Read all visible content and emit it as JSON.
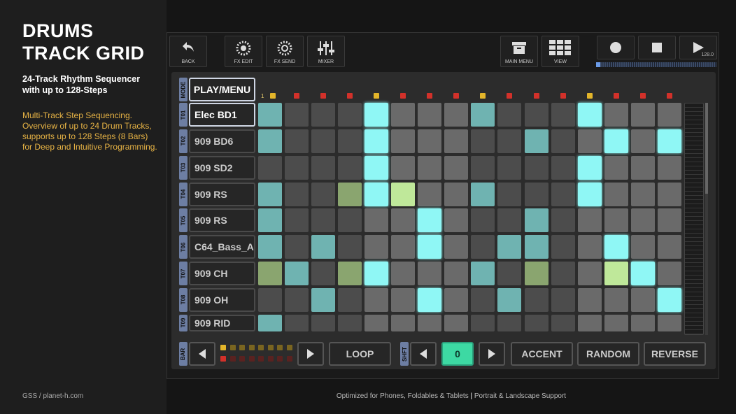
{
  "header": {
    "title_line1": "DRUMS",
    "title_line2": "TRACK GRID",
    "subtitle_line1": "24-Track Rhythm Sequencer",
    "subtitle_line2": "with up to 128-Steps",
    "desc_lines": [
      "Multi-Track Step Sequencing.",
      "Overview of up to 24 Drum Tracks,",
      "supports up to 128 Steps (8 Bars)",
      "for Deep and Intuitive Programming."
    ],
    "credit": "GSS / planet-h.com",
    "footer_left": "Optimized for Phones, Foldables & Tablets",
    "footer_sep": "|",
    "footer_right": "Portrait & Landscape Support"
  },
  "toolbar": {
    "back": "BACK",
    "fx_edit": "FX EDIT",
    "fx_send": "FX SEND",
    "mixer": "MIXER",
    "main_menu": "MAIN MENU",
    "view": "VIEW",
    "record_icon": "record-icon",
    "stop_icon": "stop-icon",
    "play_icon": "play-icon",
    "play_count": "128.0"
  },
  "mode": {
    "tag": "MODE",
    "value": "PLAY/MENU"
  },
  "step_number": "1",
  "step_indicators": [
    "yellow",
    "red",
    "red",
    "red",
    "yellow",
    "red",
    "red",
    "red",
    "yellow",
    "red",
    "red",
    "red",
    "yellow",
    "red",
    "red",
    "red"
  ],
  "tracks": [
    {
      "id": "T01",
      "name": "Elec BD1",
      "selected": true,
      "steps": [
        "teal-dim",
        "gray",
        "gray",
        "gray",
        "teal",
        "gray",
        "gray",
        "gray",
        "teal-dim",
        "gray",
        "gray",
        "gray",
        "teal",
        "gray",
        "gray",
        "gray"
      ]
    },
    {
      "id": "T02",
      "name": "909 BD6",
      "selected": false,
      "steps": [
        "teal-dim",
        "gray",
        "gray",
        "gray",
        "teal",
        "gray",
        "gray",
        "gray",
        "gray",
        "gray",
        "teal-dim",
        "gray",
        "gray",
        "teal",
        "gray",
        "teal"
      ]
    },
    {
      "id": "T03",
      "name": "909 SD2",
      "selected": false,
      "steps": [
        "gray",
        "gray",
        "gray",
        "gray",
        "teal",
        "gray",
        "gray",
        "gray",
        "gray",
        "gray",
        "gray",
        "gray",
        "teal",
        "gray",
        "gray",
        "gray"
      ]
    },
    {
      "id": "T04",
      "name": "909 RS",
      "selected": false,
      "steps": [
        "teal-dim",
        "gray",
        "gray",
        "green-dim",
        "teal",
        "green",
        "gray",
        "gray",
        "teal-dim",
        "gray",
        "gray",
        "gray",
        "teal",
        "gray",
        "gray",
        "gray"
      ]
    },
    {
      "id": "T05",
      "name": "909 RS",
      "selected": false,
      "steps": [
        "teal-dim",
        "gray",
        "gray",
        "gray",
        "gray",
        "gray",
        "teal",
        "gray",
        "gray",
        "gray",
        "teal-dim",
        "gray",
        "gray",
        "gray",
        "gray",
        "gray"
      ]
    },
    {
      "id": "T06",
      "name": "C64_Bass_A",
      "selected": false,
      "steps": [
        "teal-dim",
        "gray",
        "teal-dim",
        "gray",
        "gray",
        "gray",
        "teal",
        "gray",
        "gray",
        "teal-dim",
        "teal-dim",
        "gray",
        "gray",
        "teal",
        "gray",
        "gray"
      ]
    },
    {
      "id": "T07",
      "name": "909 CH",
      "selected": false,
      "steps": [
        "green-dim",
        "teal-dim",
        "gray",
        "green-dim",
        "teal",
        "gray",
        "gray",
        "gray",
        "teal-dim",
        "gray",
        "green-dim",
        "gray",
        "gray",
        "green",
        "teal",
        "gray"
      ]
    },
    {
      "id": "T08",
      "name": "909 OH",
      "selected": false,
      "steps": [
        "gray",
        "gray",
        "teal-dim",
        "gray",
        "gray",
        "gray",
        "teal",
        "gray",
        "gray",
        "teal-dim",
        "gray",
        "gray",
        "gray",
        "gray",
        "gray",
        "teal"
      ]
    },
    {
      "id": "T09",
      "name": "909 RID",
      "selected": false,
      "steps": [
        "teal-dim",
        "gray",
        "gray",
        "gray",
        "gray",
        "gray",
        "gray",
        "gray",
        "gray",
        "gray",
        "gray",
        "gray",
        "gray",
        "gray",
        "gray",
        "gray"
      ]
    }
  ],
  "bottom": {
    "bar_tag": "BAR",
    "left_arrow": "left-arrow-icon",
    "right_arrow": "right-arrow-icon",
    "loop": "LOOP",
    "shift_tag": "SHFT",
    "shift_value": "0",
    "accent": "ACCENT",
    "random": "RANDOM",
    "reverse": "REVERSE",
    "bar_row1": [
      "yellow",
      "yellow-dim",
      "yellow-dim",
      "yellow-dim",
      "yellow-dim",
      "yellow-dim",
      "yellow-dim",
      "yellow-dim"
    ],
    "bar_row2": [
      "red",
      "red-dim",
      "red-dim",
      "red-dim",
      "red-dim",
      "red-dim",
      "red-dim",
      "red-dim"
    ]
  },
  "colors": {
    "gray": "#6a6a6a",
    "gray_dark": "#4c4c4c",
    "teal": "#8ff7f5",
    "teal_dim": "#6fb3b1",
    "green": "#bfe89a",
    "green_dim": "#8aa56f",
    "accent_orange": "#e8b445"
  }
}
